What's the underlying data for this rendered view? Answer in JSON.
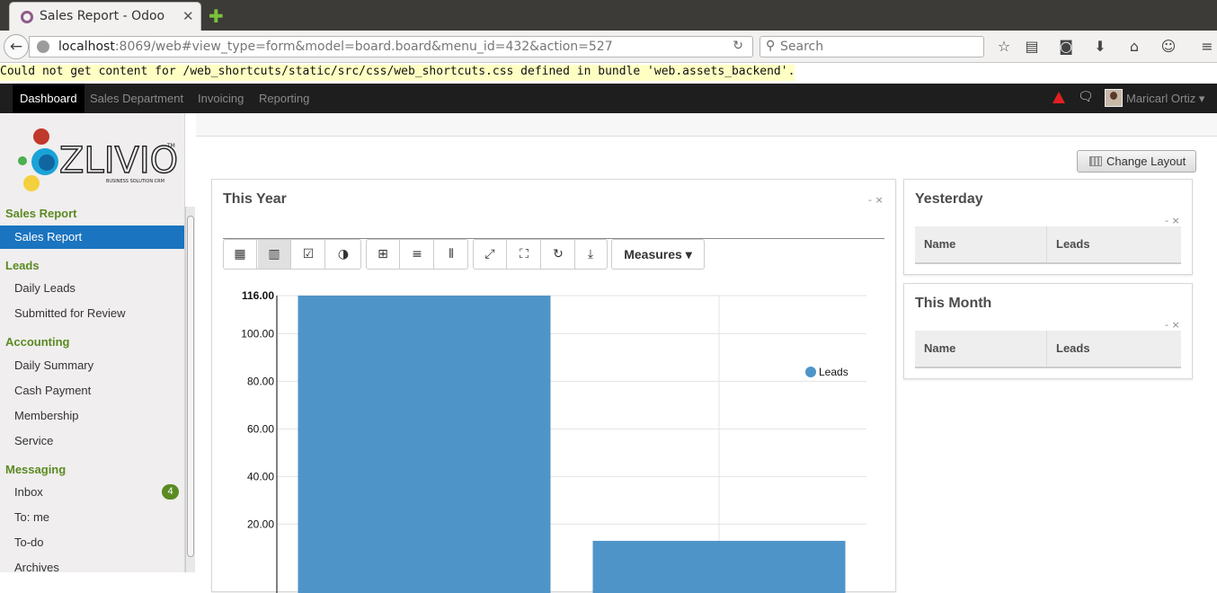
{
  "browser": {
    "tab_title": "Sales Report - Odoo",
    "close_glyph": "✕",
    "new_tab_glyph": "✚",
    "url_host": "localhost",
    "url_rest": ":8069/web#view_type=form&model=board.board&menu_id=432&action=527",
    "search_placeholder": "Search"
  },
  "error_message": "Could not get content for /web_shortcuts/static/src/css/web_shortcuts.css defined in bundle 'web.assets_backend'.",
  "topbar": {
    "menus": [
      "Dashboard",
      "Sales Department",
      "Invoicing",
      "Reporting"
    ],
    "user": "Maricarl Ortiz ▾"
  },
  "sidebar": {
    "logo_text": "ZLIVIO",
    "logo_tm": "TM",
    "logo_tagline": "BUSINESS SOLUTION CRM",
    "sections": [
      {
        "title": "Sales Report",
        "items": [
          "Sales Report"
        ]
      },
      {
        "title": "Leads",
        "items": [
          "Daily Leads",
          "Submitted for Review"
        ]
      },
      {
        "title": "Accounting",
        "items": [
          "Daily Summary",
          "Cash Payment",
          "Membership",
          "Service"
        ]
      },
      {
        "title": "Messaging",
        "items": [
          "Inbox",
          "To: me",
          "To-do",
          "Archives"
        ]
      }
    ],
    "inbox_badge": "4"
  },
  "dashboard": {
    "change_layout": "Change Layout",
    "panels": {
      "this_year": {
        "title": "This Year",
        "controls": "- ×"
      },
      "yesterday": {
        "title": "Yesterday",
        "controls": "- ×",
        "columns": [
          "Name",
          "Leads"
        ]
      },
      "this_month": {
        "title": "This Month",
        "controls": "- ×",
        "columns": [
          "Name",
          "Leads"
        ]
      }
    },
    "measures_label": "Measures ▾"
  },
  "colors": {
    "bar": "#4f94c8",
    "accent_green": "#5a8a22",
    "active_blue": "#1a74c0"
  },
  "chart_data": {
    "type": "bar",
    "categories": [
      "",
      ""
    ],
    "series": [
      {
        "name": "Leads",
        "values": [
          116,
          13
        ]
      }
    ],
    "yticks": [
      "20.00",
      "40.00",
      "60.00",
      "80.00",
      "100.00",
      "116.00"
    ],
    "ylim": [
      0,
      116
    ],
    "legend_position": "top-right",
    "grid": true
  }
}
